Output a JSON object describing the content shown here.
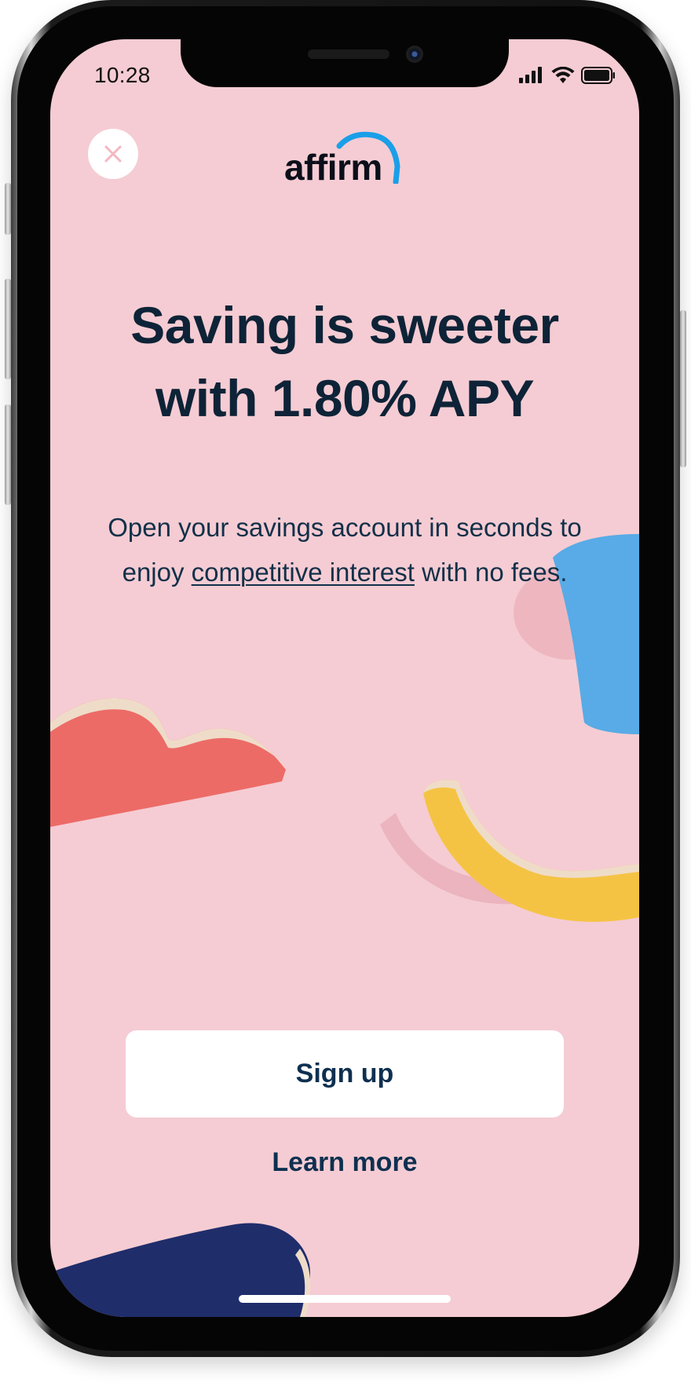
{
  "status_bar": {
    "time": "10:28",
    "icons": [
      "signal-icon",
      "wifi-icon",
      "battery-icon"
    ]
  },
  "header": {
    "close_icon": "close-icon",
    "logo_text": "affirm",
    "logo_accent_color": "#1a9fe8"
  },
  "hero": {
    "title_line1": "Saving is sweeter",
    "title_line2": "with 1.80% APY",
    "subtitle_line1": "Open your savings account in seconds to",
    "subtitle_before_link": "enjoy ",
    "subtitle_link": "competitive interest",
    "subtitle_after_link": " with no fees."
  },
  "actions": {
    "signup_label": "Sign up",
    "learn_more_label": "Learn more"
  },
  "colors": {
    "background": "#f5ccd3",
    "text_dark": "#0e2337",
    "button_bg": "#ffffff",
    "shape_red": "#ec6b67",
    "shape_yellow": "#f5c344",
    "shape_blue": "#58abe6",
    "shape_navy": "#1f2d6b"
  }
}
